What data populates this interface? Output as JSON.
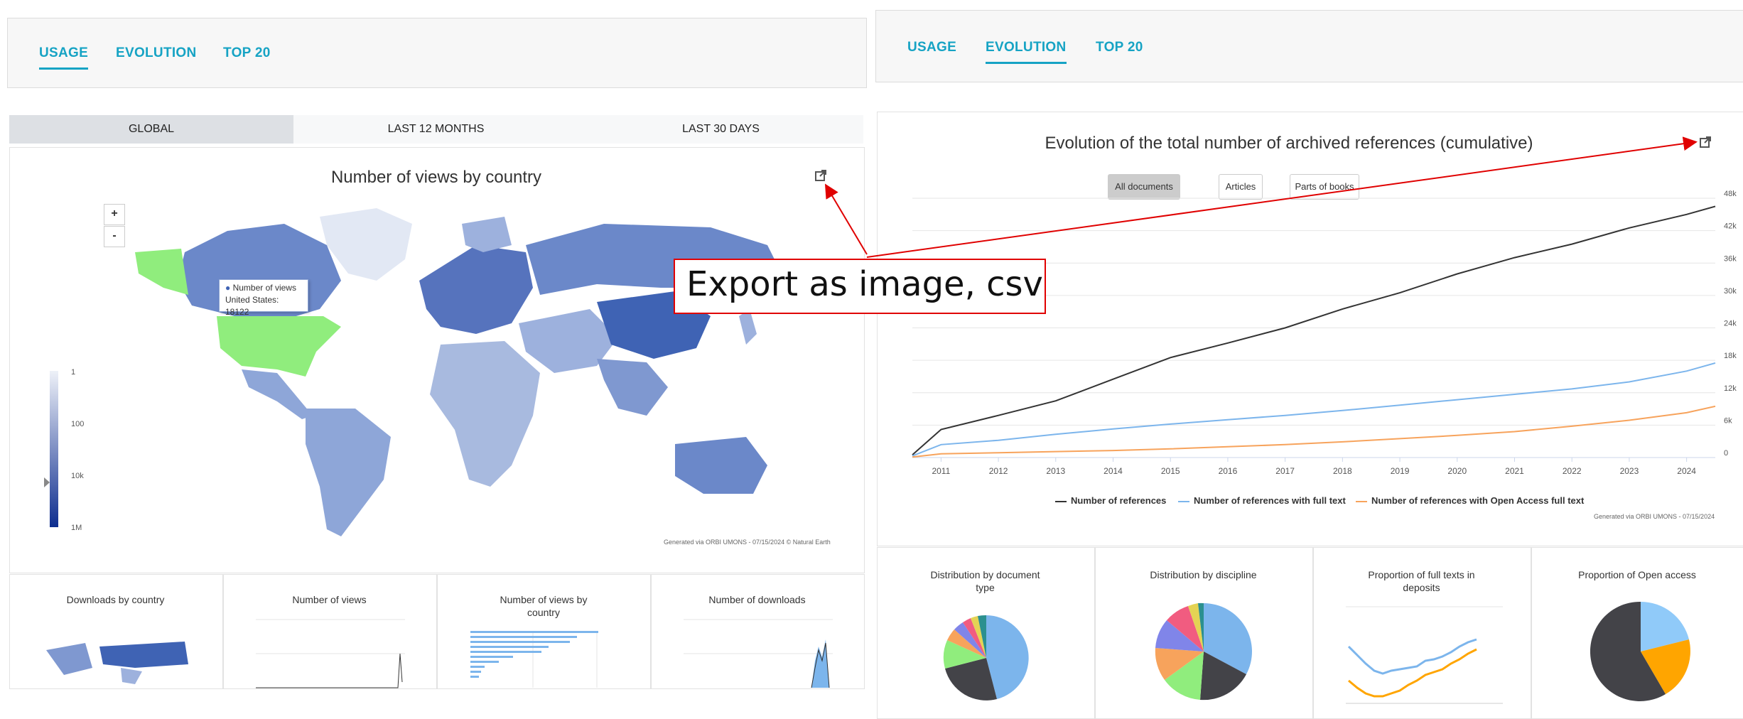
{
  "left": {
    "tabs": [
      "USAGE",
      "EVOLUTION",
      "TOP 20"
    ],
    "active_tab": "USAGE",
    "periods": [
      "GLOBAL",
      "LAST 12 MONTHS",
      "LAST 30 DAYS"
    ],
    "active_period": "GLOBAL",
    "map": {
      "title": "Number of views by country",
      "zoom_in": "+",
      "zoom_out": "-",
      "tooltip_series": "Number of views",
      "tooltip_value": "United States: 18122",
      "legend_labels": [
        "1",
        "100",
        "10k",
        "1M"
      ],
      "credit": "Generated via ORBI UMONS - 07/15/2024 © Natural Earth",
      "export_icon": "external-link-icon"
    },
    "mini_charts": [
      "Downloads by country",
      "Number of views",
      "Number of views by country",
      "Number of downloads"
    ]
  },
  "callout": {
    "text": "Export as image, csv",
    "color": "#e00000"
  },
  "right": {
    "tabs": [
      "USAGE",
      "EVOLUTION",
      "TOP 20"
    ],
    "active_tab": "EVOLUTION",
    "chart": {
      "title": "Evolution of the total number of archived references (cumulative)",
      "filters": [
        "All documents",
        "Articles",
        "Parts of books"
      ],
      "selected_filter": "All documents",
      "y_ticks": [
        "48k",
        "42k",
        "36k",
        "30k",
        "24k",
        "18k",
        "12k",
        "6k",
        "0"
      ],
      "x_ticks": [
        "2011",
        "2012",
        "2013",
        "2014",
        "2015",
        "2016",
        "2017",
        "2018",
        "2019",
        "2020",
        "2021",
        "2022",
        "2023",
        "2024"
      ],
      "legend": [
        "Number of references",
        "Number of references with full text",
        "Number of references with Open Access full text"
      ],
      "credit": "Generated via ORBI UMONS - 07/15/2024",
      "export_icon": "external-link-icon"
    },
    "mini_charts": [
      "Distribution by document type",
      "Distribution by discipline",
      "Proportion of full texts in deposits",
      "Proportion of Open access"
    ]
  },
  "colors": {
    "accent": "#16a3c4",
    "series_refs": "#333333",
    "series_fulltext": "#7cb5ec",
    "series_oa": "#f7a35c",
    "highlight": "#90ed7d"
  },
  "chart_data": {
    "type": "line",
    "title": "Evolution of the total number of archived references (cumulative)",
    "x": [
      2010.5,
      2011,
      2012,
      2013,
      2014,
      2015,
      2016,
      2017,
      2018,
      2019,
      2020,
      2021,
      2022,
      2023,
      2024,
      2024.5
    ],
    "ylim": [
      0,
      48000
    ],
    "series": [
      {
        "name": "Number of references",
        "values": [
          500,
          5200,
          7800,
          10500,
          14500,
          18500,
          21200,
          24000,
          27500,
          30500,
          34000,
          37000,
          39500,
          42500,
          45000,
          46500
        ]
      },
      {
        "name": "Number of references with full text",
        "values": [
          300,
          2400,
          3200,
          4300,
          5300,
          6200,
          7000,
          7800,
          8700,
          9700,
          10700,
          11700,
          12700,
          14000,
          16000,
          17500
        ]
      },
      {
        "name": "Number of references with Open Access full text",
        "values": [
          100,
          700,
          900,
          1100,
          1300,
          1600,
          2000,
          2400,
          2900,
          3500,
          4100,
          4800,
          5800,
          6900,
          8300,
          9500
        ]
      }
    ]
  }
}
